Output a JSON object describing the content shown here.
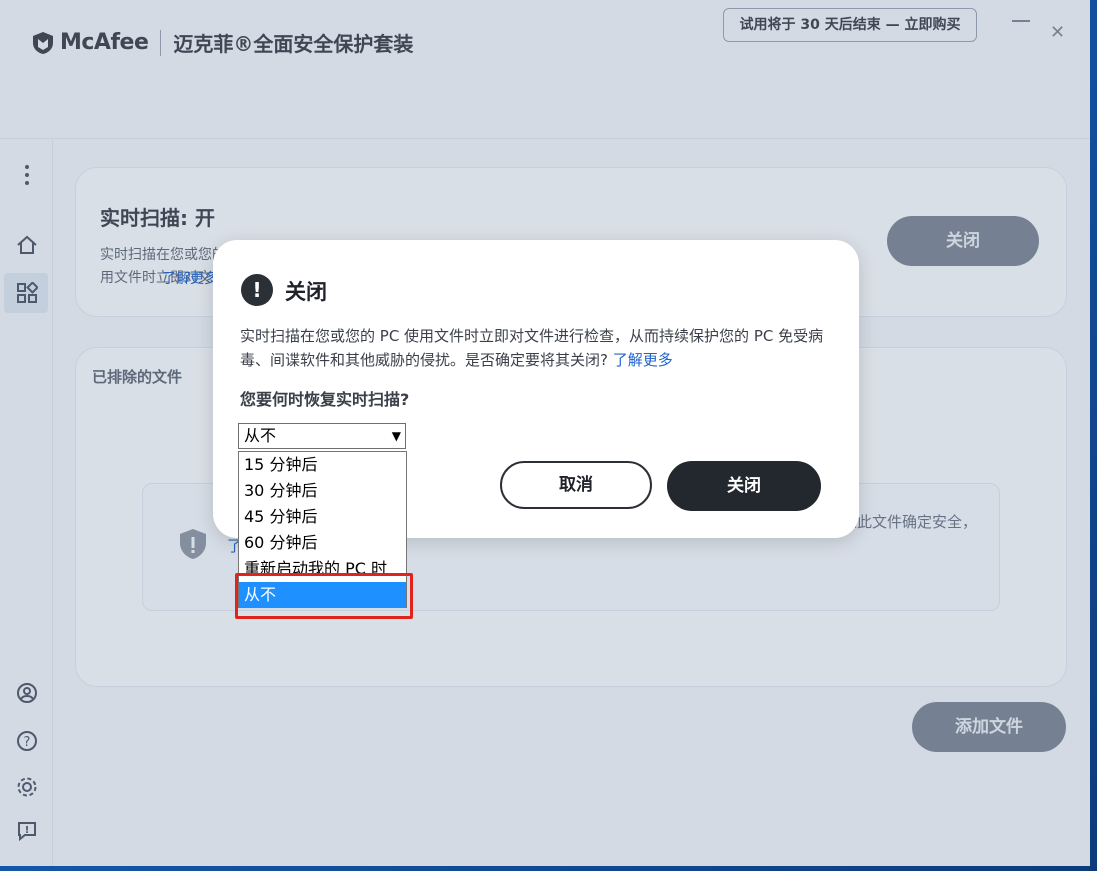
{
  "app": {
    "brand": "McAfee",
    "product": "迈克菲®全面安全保护套装",
    "trial_banner": "试用将于 30 天后结束 — 立即购买"
  },
  "realtime_card": {
    "title": "实时扫描: 开",
    "desc": "实时扫描在您或您的 PC 使用文件时立即对文件进行检查，从而持续保护您的 PC 免受病毒、间谍软件和其他威胁的侵扰。",
    "learn_more": "了解更多",
    "close_button": "关闭"
  },
  "excluded_card": {
    "title": "已排除的文件",
    "info_text": "这些文件不会被实时扫描检查。如果已排除文件发生更改，我们会将其从排除列表中删除。如果此文件确定安全，",
    "learn_more": "了解更多",
    "add_button": "添加文件"
  },
  "dialog": {
    "title": "关闭",
    "desc": "实时扫描在您或您的 PC 使用文件时立即对文件进行检查，从而持续保护您的 PC 免受病毒、间谍软件和其他威胁的侵扰。是否确定要将其关闭?",
    "learn_more": "了解更多",
    "question": "您要何时恢复实时扫描?",
    "selected": "从不",
    "options": [
      "15 分钟后",
      "30 分钟后",
      "45 分钟后",
      "60 分钟后",
      "重新启动我的 PC 时",
      "从不"
    ],
    "cancel": "取消",
    "confirm": "关闭"
  }
}
